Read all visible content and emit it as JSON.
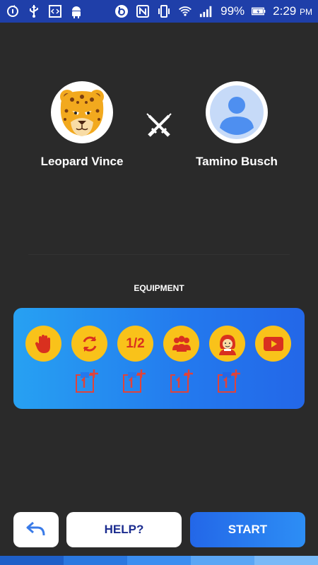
{
  "statusbar": {
    "battery": "99%",
    "time": "2:29",
    "ampm": "PM"
  },
  "players": {
    "left": {
      "name": "Leopard Vince",
      "avatar_icon": "leopard-avatar"
    },
    "right": {
      "name": "Tamino Busch",
      "avatar_icon": "default-user-avatar"
    },
    "vs_icon": "crossed-swords-icon"
  },
  "equipment": {
    "label": "EQUIPMENT",
    "items": [
      {
        "icon": "stop-hand-icon"
      },
      {
        "icon": "refresh-icon"
      },
      {
        "icon": "half-icon",
        "text": "1/2"
      },
      {
        "icon": "audience-icon"
      },
      {
        "icon": "phone-a-friend-icon"
      },
      {
        "icon": "video-play-icon"
      }
    ],
    "slots": [
      "1+",
      "1+",
      "1+",
      "1+"
    ]
  },
  "buttons": {
    "back_icon": "back-arrow-icon",
    "help": "HELP?",
    "start": "START"
  },
  "colors": {
    "background": "#2a2a2a",
    "statusbar": "#1f3fa9",
    "card_gradient_start": "#27a1f2",
    "card_gradient_end": "#2367e8",
    "item_yellow": "#f9c21a",
    "item_red": "#d9301f",
    "help_text": "#1b2c8f"
  }
}
